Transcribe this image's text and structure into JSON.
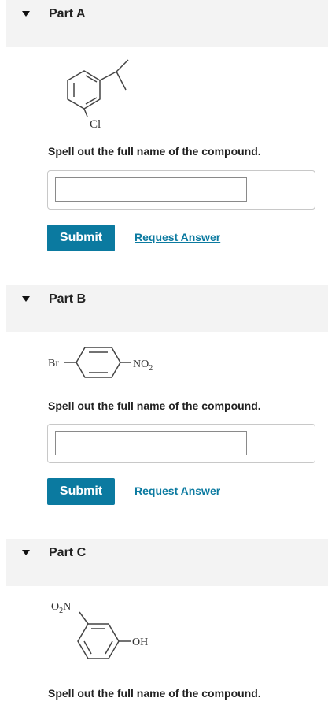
{
  "parts": [
    {
      "title": "Part A",
      "structure_labels": {
        "substituent": "Cl"
      },
      "prompt": "Spell out the full name of the compound.",
      "answer_value": "",
      "submit_label": "Submit",
      "request_label": "Request Answer"
    },
    {
      "title": "Part B",
      "structure_labels": {
        "left": "Br",
        "right_main": "NO",
        "right_sub": "2"
      },
      "prompt": "Spell out the full name of the compound.",
      "answer_value": "",
      "submit_label": "Submit",
      "request_label": "Request Answer"
    },
    {
      "title": "Part C",
      "structure_labels": {
        "top_pre": "O",
        "top_sub": "2",
        "top_post": "N",
        "right": "OH"
      },
      "prompt": "Spell out the full name of the compound."
    }
  ],
  "icons": {
    "collapse": "triangle-down-icon"
  },
  "colors": {
    "accent": "#0b7aa0",
    "header_bg": "#f3f3f3"
  }
}
